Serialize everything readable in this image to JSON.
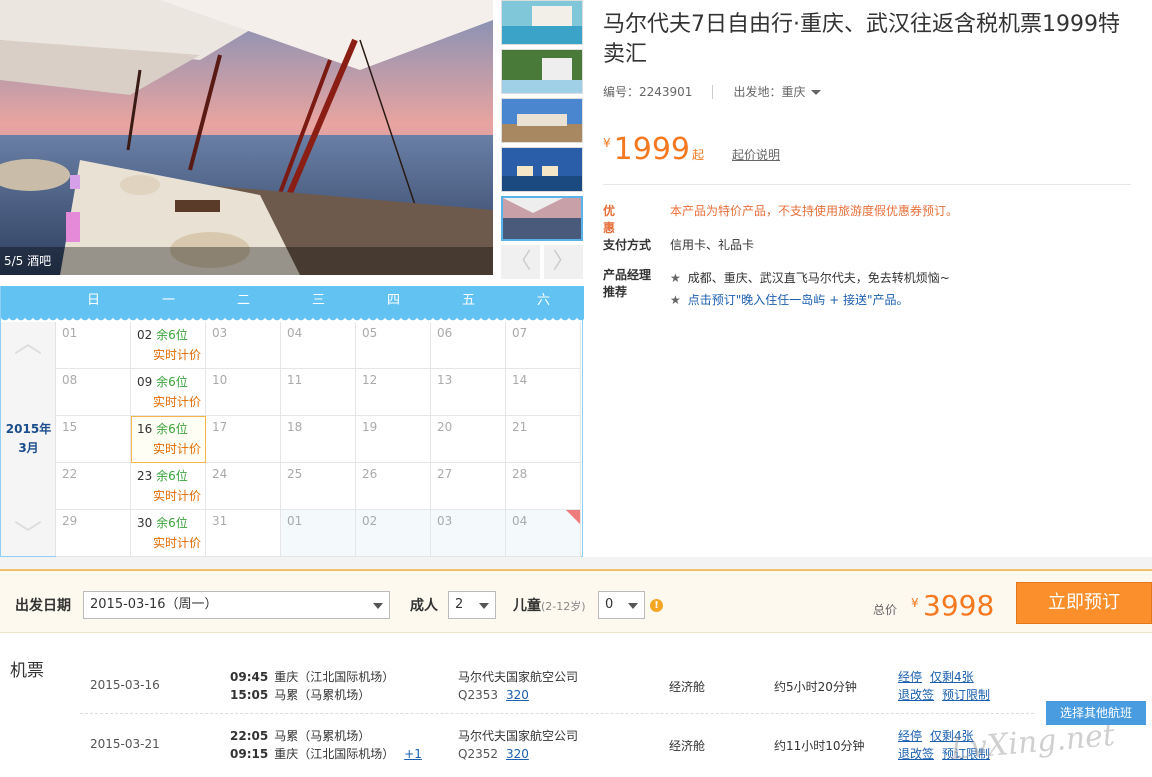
{
  "gallery": {
    "caption": "5/5 酒吧",
    "prev_icon": "〈",
    "next_icon": "〉"
  },
  "calendar": {
    "weekdays": [
      "日",
      "一",
      "二",
      "三",
      "四",
      "五",
      "六"
    ],
    "month_year": "2015年",
    "month": "3月",
    "up_icon": "︿",
    "down_icon": "﹀",
    "cells": [
      {
        "day": "01",
        "avail": "",
        "price": ""
      },
      {
        "day": "02",
        "avail": "余6位",
        "price": "实时计价"
      },
      {
        "day": "03",
        "avail": "",
        "price": ""
      },
      {
        "day": "04",
        "avail": "",
        "price": ""
      },
      {
        "day": "05",
        "avail": "",
        "price": ""
      },
      {
        "day": "06",
        "avail": "",
        "price": ""
      },
      {
        "day": "07",
        "avail": "",
        "price": ""
      },
      {
        "day": "08",
        "avail": "",
        "price": ""
      },
      {
        "day": "09",
        "avail": "余6位",
        "price": "实时计价"
      },
      {
        "day": "10",
        "avail": "",
        "price": ""
      },
      {
        "day": "11",
        "avail": "",
        "price": ""
      },
      {
        "day": "12",
        "avail": "",
        "price": ""
      },
      {
        "day": "13",
        "avail": "",
        "price": ""
      },
      {
        "day": "14",
        "avail": "",
        "price": ""
      },
      {
        "day": "15",
        "avail": "",
        "price": ""
      },
      {
        "day": "16",
        "avail": "余6位",
        "price": "实时计价"
      },
      {
        "day": "17",
        "avail": "",
        "price": ""
      },
      {
        "day": "18",
        "avail": "",
        "price": ""
      },
      {
        "day": "19",
        "avail": "",
        "price": ""
      },
      {
        "day": "20",
        "avail": "",
        "price": ""
      },
      {
        "day": "21",
        "avail": "",
        "price": ""
      },
      {
        "day": "22",
        "avail": "",
        "price": ""
      },
      {
        "day": "23",
        "avail": "余6位",
        "price": "实时计价"
      },
      {
        "day": "24",
        "avail": "",
        "price": ""
      },
      {
        "day": "25",
        "avail": "",
        "price": ""
      },
      {
        "day": "26",
        "avail": "",
        "price": ""
      },
      {
        "day": "27",
        "avail": "",
        "price": ""
      },
      {
        "day": "28",
        "avail": "",
        "price": ""
      },
      {
        "day": "29",
        "avail": "",
        "price": ""
      },
      {
        "day": "30",
        "avail": "余6位",
        "price": "实时计价"
      },
      {
        "day": "31",
        "avail": "",
        "price": ""
      },
      {
        "day": "01",
        "avail": "",
        "price": ""
      },
      {
        "day": "02",
        "avail": "",
        "price": ""
      },
      {
        "day": "03",
        "avail": "",
        "price": ""
      },
      {
        "day": "04",
        "avail": "",
        "price": ""
      }
    ]
  },
  "product": {
    "title": "马尔代夫7日自由行·重庆、武汉往返含税机票1999特卖汇",
    "code": "编号：2243901",
    "departure_label": "出发地：",
    "departure_value": "重庆",
    "yen": "¥",
    "price": "1999",
    "price_suffix": "起",
    "price_explain": "起价说明",
    "promo_label": "优惠",
    "promo_text": "本产品为特价产品，不支持使用旅游度假优惠券预订。",
    "payment_label": "支付方式",
    "payment_value": "信用卡、礼品卡",
    "manager_label_1": "产品经理",
    "manager_label_2": "推荐",
    "star": "★",
    "manager_line_1": "成都、重庆、武汉直飞马尔代夫，免去转机烦恼~",
    "manager_line_2": "点击预订\"晚入住任一岛屿 + 接送\"产品。"
  },
  "booking": {
    "date_label": "出发日期",
    "date_value": "2015-03-16（周一）",
    "adult_label": "成人",
    "adult_value": "2",
    "child_label": "儿童",
    "child_range": "(2-12岁)",
    "child_value": "0",
    "info_icon": "!",
    "total_label": "总价",
    "total_yen": "¥",
    "total_price": "3998",
    "book_button": "立即预订"
  },
  "flights": {
    "label": "机票",
    "other_button": "选择其他航班",
    "rows": [
      {
        "date": "2015-03-16",
        "dep_time": "09:45",
        "dep_airport": "重庆（江北国际机场）",
        "arr_time": "15:05",
        "arr_airport": "马累（马累机场）",
        "plus_day": "",
        "airline": "马尔代夫国家航空公司",
        "flight_no": "Q2353",
        "aircraft": "320",
        "cabin": "经济舱",
        "duration": "约5小时20分钟",
        "link1": "经停",
        "link2": "仅剩4张",
        "link3": "退改签",
        "link4": "预订限制"
      },
      {
        "date": "2015-03-21",
        "dep_time": "22:05",
        "dep_airport": "马累（马累机场）",
        "arr_time": "09:15",
        "arr_airport": "重庆（江北国际机场）",
        "plus_day": "+1",
        "airline": "马尔代夫国家航空公司",
        "flight_no": "Q2352",
        "aircraft": "320",
        "cabin": "经济舱",
        "duration": "约11小时10分钟",
        "link1": "经停",
        "link2": "仅剩4张",
        "link3": "退改签",
        "link4": "预订限制"
      }
    ]
  },
  "watermark": "LvXing.net"
}
